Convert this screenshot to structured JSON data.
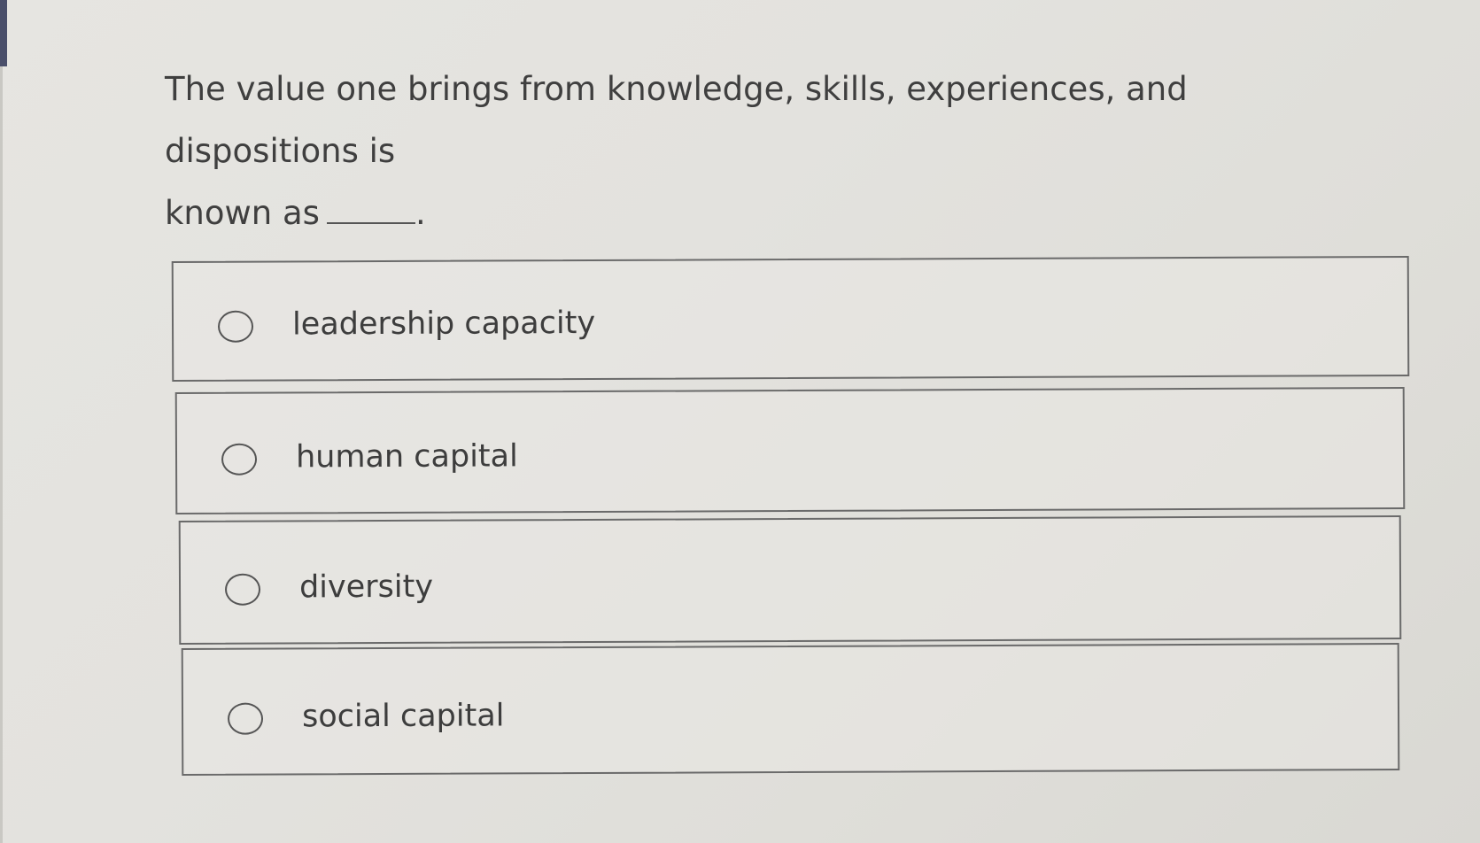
{
  "question": {
    "text_line1": "The value one brings from knowledge, skills, experiences, and dispositions is",
    "text_line2": "known as",
    "blank_suffix": "."
  },
  "options": [
    {
      "label": "leadership capacity",
      "selected": false
    },
    {
      "label": "human capital",
      "selected": false
    },
    {
      "label": "diversity",
      "selected": false
    },
    {
      "label": "social capital",
      "selected": false
    }
  ]
}
